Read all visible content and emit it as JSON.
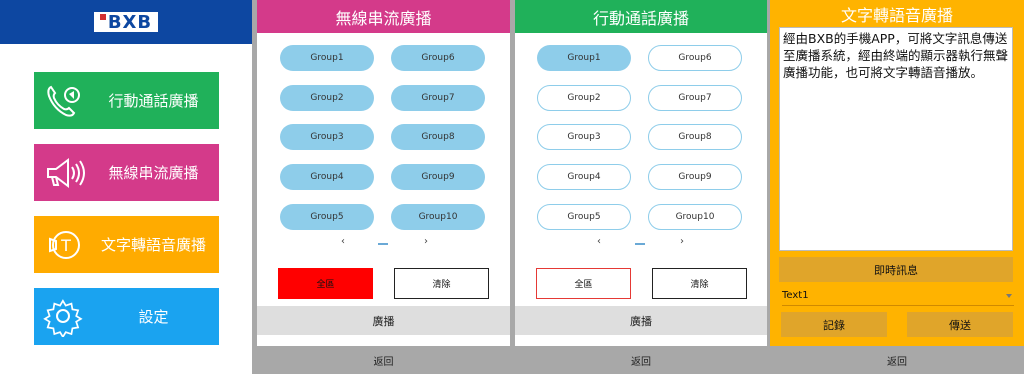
{
  "main_menu": {
    "logo": "BXB",
    "items": [
      {
        "label": "行動通話廣播",
        "color": "#20b15a",
        "icon": "phone-icon"
      },
      {
        "label": "無線串流廣播",
        "color": "#d43a8a",
        "icon": "megaphone-icon"
      },
      {
        "label": "文字轉語音廣播",
        "color": "#ffab00",
        "icon": "text-to-speech-icon"
      },
      {
        "label": "設定",
        "color": "#1aa3f0",
        "icon": "gear-icon"
      }
    ]
  },
  "streaming_panel": {
    "title": "無線串流廣播",
    "header_color": "#d43a8a",
    "groups": [
      "Group1",
      "Group6",
      "Group2",
      "Group7",
      "Group3",
      "Group8",
      "Group4",
      "Group9",
      "Group5",
      "Group10"
    ],
    "prev": "‹",
    "next": "›",
    "select_all": "全區",
    "clear": "清除",
    "broadcast": "廣播",
    "back": "返回"
  },
  "mobile_panel": {
    "title": "行動通話廣播",
    "header_color": "#20b15a",
    "groups": [
      "Group1",
      "Group6",
      "Group2",
      "Group7",
      "Group3",
      "Group8",
      "Group4",
      "Group9",
      "Group5",
      "Group10"
    ],
    "prev": "‹",
    "next": "›",
    "select_all": "全區",
    "clear": "清除",
    "broadcast": "廣播",
    "back": "返回"
  },
  "tts_panel": {
    "title": "文字轉語音廣播",
    "header_color": "#ffb300",
    "text": "經由BXB的手機APP，可將文字訊息傳送至廣播系統，經由終端的顯示器執行無聲廣播功能，也可將文字轉語音播放。",
    "instant_message": "即時訊息",
    "select_value": "Text1",
    "record": "記錄",
    "send": "傳送",
    "back": "返回"
  }
}
